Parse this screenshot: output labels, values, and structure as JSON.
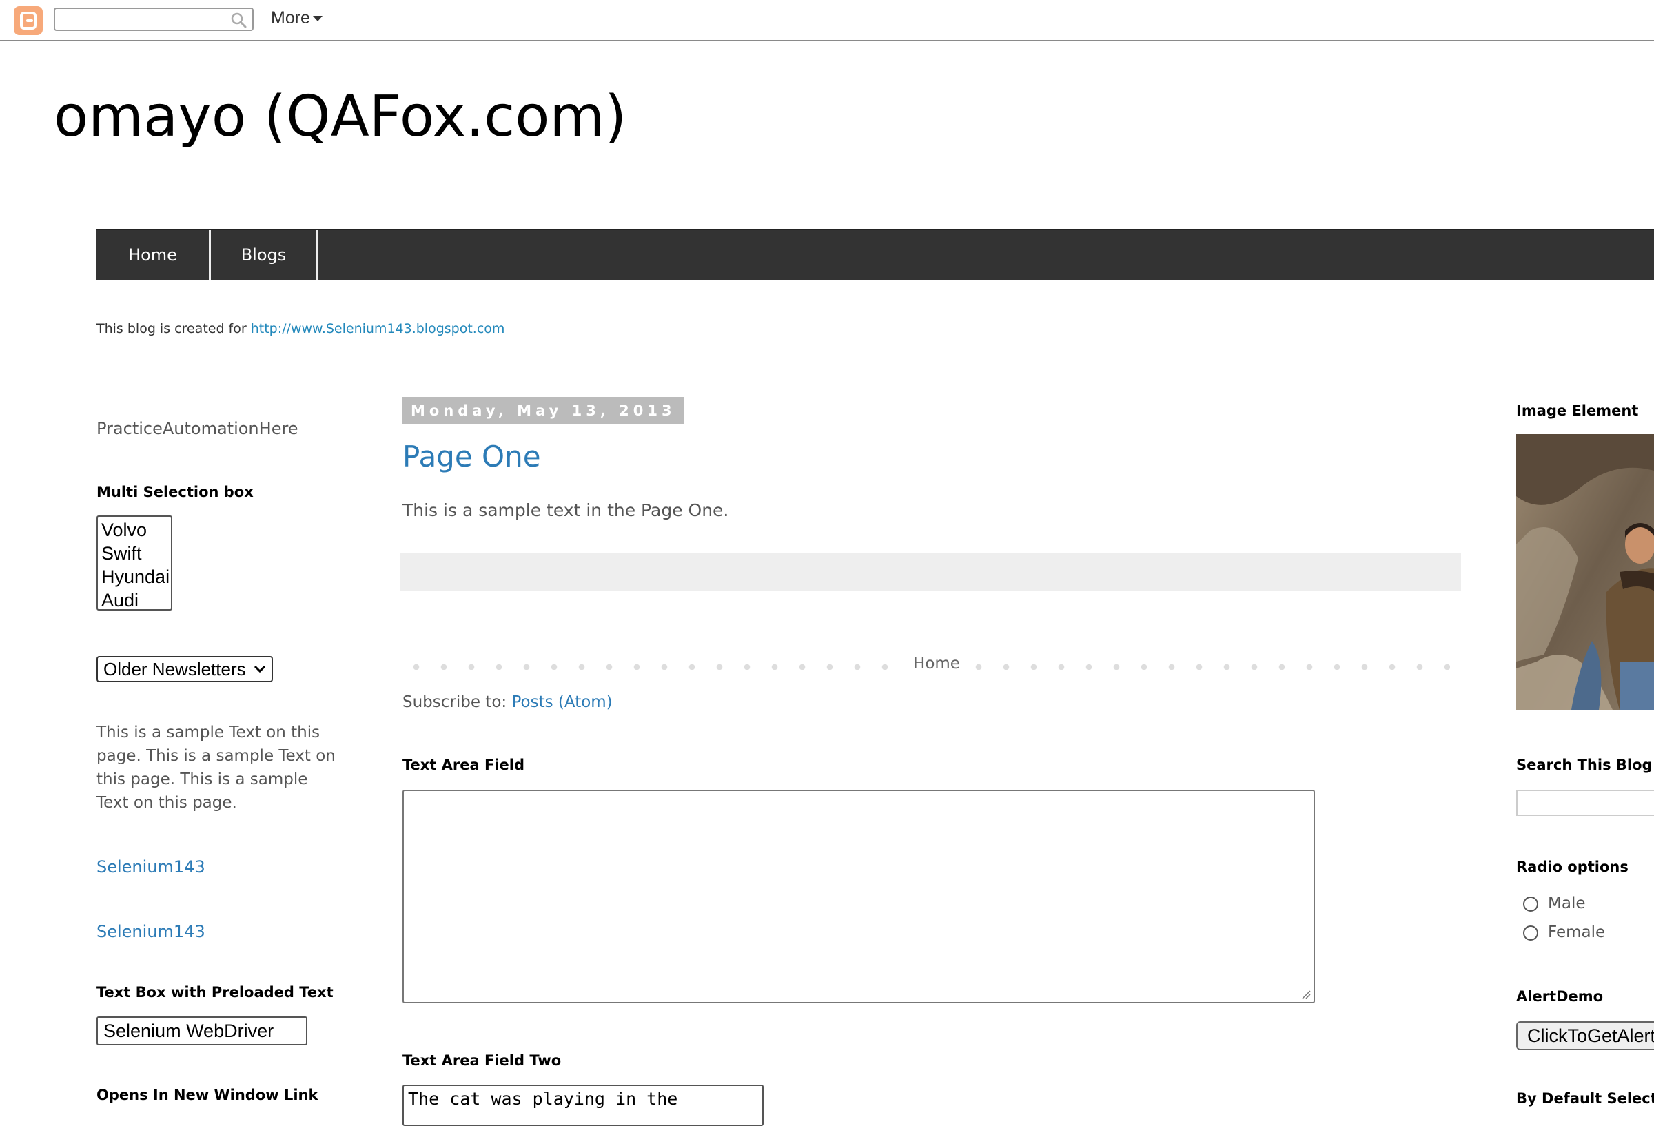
{
  "navbar": {
    "search_value": "",
    "more_label": "More"
  },
  "header": {
    "title": "omayo (QAFox.com)"
  },
  "tabs": [
    {
      "label": "Home"
    },
    {
      "label": "Blogs"
    }
  ],
  "description": {
    "prefix": "This blog is created for ",
    "link_text": "http://www.Selenium143.blogspot.com"
  },
  "left_sidebar": {
    "practice_label": "PracticeAutomationHere",
    "multi_select": {
      "heading": "Multi Selection box",
      "options": [
        "Volvo",
        "Swift",
        "Hyundai",
        "Audi"
      ]
    },
    "dropdown": {
      "selected": "Older Newsletters"
    },
    "sample_text": "This is a sample Text on this page. This is a sample Text on this page. This is a sample Text on this page.",
    "links": [
      "Selenium143",
      "Selenium143"
    ],
    "preloaded": {
      "heading": "Text Box with Preloaded Text",
      "value": "Selenium WebDriver"
    },
    "new_window_heading": "Opens In New Window Link"
  },
  "main": {
    "date": "Monday, May 13, 2013",
    "post_title": "Page One",
    "post_body": "This is a sample text in the Page One.",
    "pager_home": "Home",
    "subscribe_prefix": "Subscribe to: ",
    "subscribe_link": "Posts (Atom)",
    "textarea1": {
      "heading": "Text Area Field",
      "value": ""
    },
    "textarea2": {
      "heading": "Text Area Field Two",
      "value": "The cat was playing in the"
    }
  },
  "right_sidebar": {
    "image_heading": "Image Element",
    "search_heading": "Search This Blog",
    "search_value": "",
    "radio": {
      "heading": "Radio options",
      "options": [
        "Male",
        "Female"
      ]
    },
    "alert": {
      "heading": "AlertDemo",
      "button_label": "ClickToGetAlert"
    },
    "default_selected_heading": "By Default Selected"
  },
  "colors": {
    "navbar_logo": "#f7a97a",
    "tab_bar": "#333333",
    "link": "#2c7bb6",
    "date_header": "#bbbbbb"
  }
}
